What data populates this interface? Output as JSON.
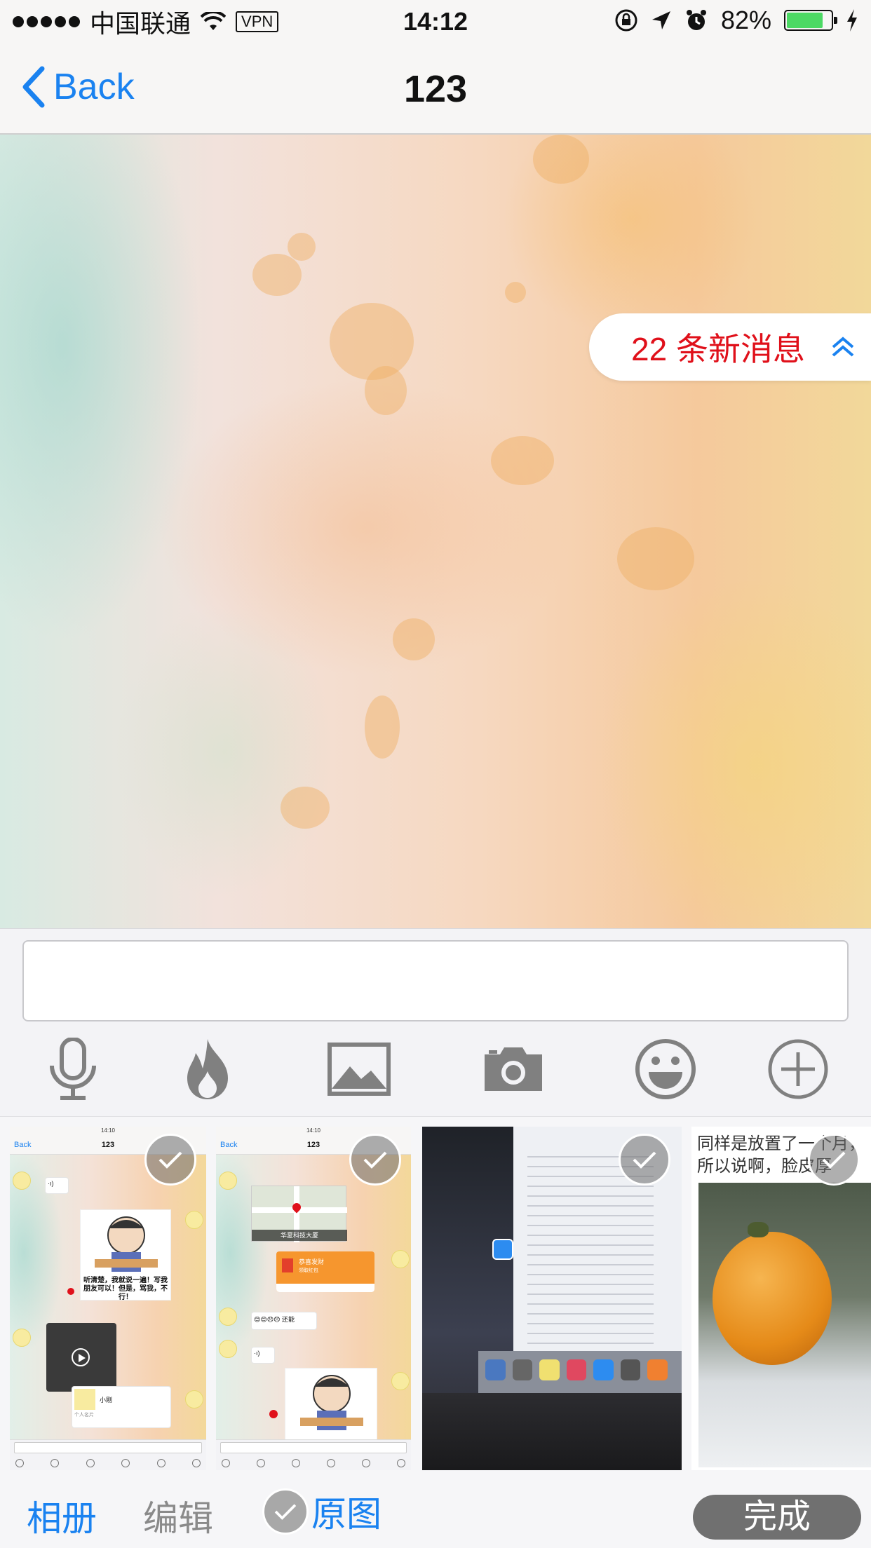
{
  "status_bar": {
    "carrier": "中国联通",
    "vpn": "VPN",
    "time": "14:12",
    "battery": "82%",
    "battery_level": 0.82
  },
  "nav": {
    "back_label": "Back",
    "title": "123"
  },
  "new_messages": {
    "label": "22 条新消息"
  },
  "input": {
    "placeholder": ""
  },
  "toolbar": {
    "icons": [
      "microphone-icon",
      "fire-icon",
      "image-icon",
      "camera-icon",
      "emoji-icon",
      "plus-icon"
    ]
  },
  "photos": {
    "thumb1": {
      "status_time": "14:10",
      "back": "Back",
      "title": "123",
      "meme_caption": "听清楚，我就说一遍！写我朋友可以！但是，骂我，不行！",
      "card_label": "小刚",
      "card_sub": "个人名片"
    },
    "thumb2": {
      "status_time": "14:10",
      "back": "Back",
      "title": "123",
      "map_label": "华夏科技大厦",
      "redpacket_title": "恭喜发财",
      "redpacket_sub": "领取红包",
      "emoji_text": "😊😊😞😞 还能"
    },
    "thumb4": {
      "text_line1": "同样是放置了一个月，",
      "text_line2": "所以说啊，脸皮厚"
    }
  },
  "bottom_bar": {
    "album": "相册",
    "edit": "编辑",
    "original": "原图",
    "done": "完成"
  },
  "colors": {
    "accent": "#1a82f0",
    "alert": "#e0101a",
    "battery": "#4cd964"
  }
}
